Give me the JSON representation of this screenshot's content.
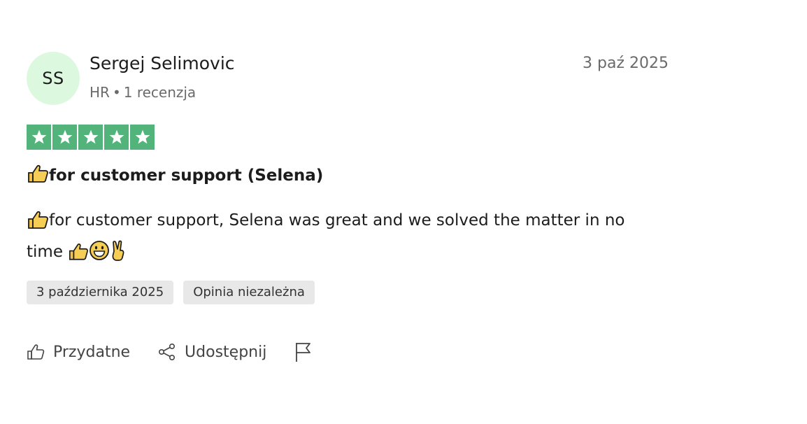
{
  "review": {
    "avatar_initials": "SS",
    "reviewer_name": "Sergej Selimovic",
    "country": "HR",
    "separator": "•",
    "review_count": "1 recenzja",
    "date_short": "3 paź 2025",
    "rating": {
      "value": 5,
      "max": 5,
      "color": "#53b47b"
    },
    "title": "for customer support (Selena)",
    "body_text_1": "for customer support, Selena was great and we solved the matter in no time",
    "icons": {
      "title_emoji": "thumbs-up-icon",
      "body_emojis": [
        "thumbs-up-icon",
        "thumbs-up-icon",
        "grinning-face-icon",
        "victory-hand-icon"
      ]
    },
    "tags": [
      "3 października 2025",
      "Opinia niezależna"
    ],
    "actions": {
      "helpful_label": "Przydatne",
      "share_label": "Udostępnij",
      "report_icon": "flag-icon"
    }
  }
}
